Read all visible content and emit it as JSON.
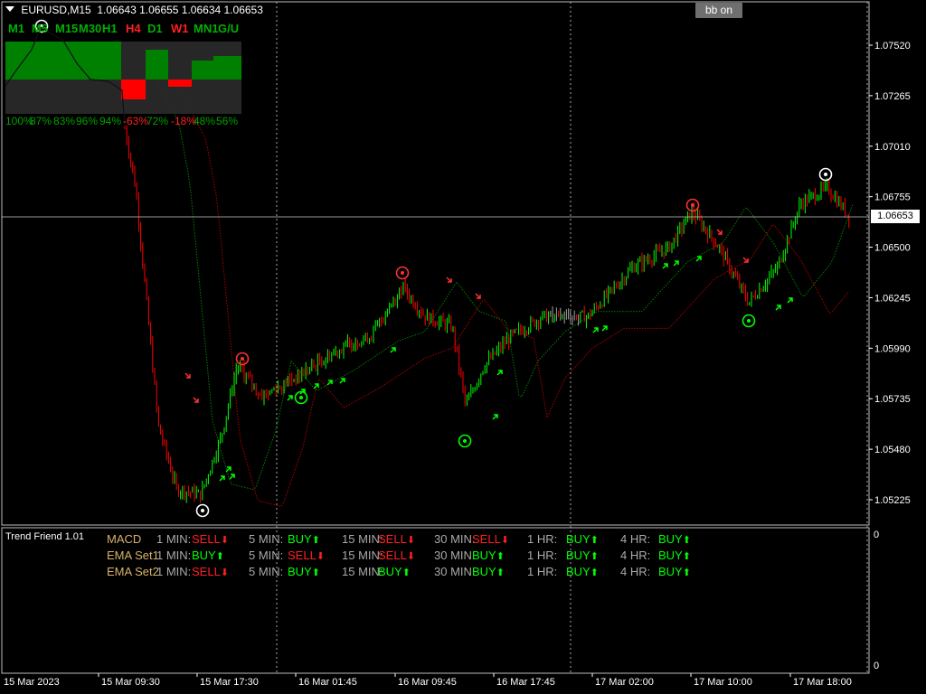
{
  "header": {
    "symbol": "EURUSD,M15",
    "ohlc": "1.06643 1.06655 1.06634 1.06653"
  },
  "toolbar": {
    "bb_label": "bb on"
  },
  "colors": {
    "bull": "#00ff00",
    "bear": "#ff0000",
    "neutral": "#a0a0a0",
    "grid": "#aaaaaa",
    "panel_green": "#008000",
    "panel_dark": "#2a2a2a"
  },
  "price_axis": {
    "labels": [
      "1.07520",
      "1.07265",
      "1.07010",
      "1.06755",
      "1.06500",
      "1.06245",
      "1.05990",
      "1.05735",
      "1.05480",
      "1.05225"
    ],
    "current": "1.06653"
  },
  "time_axis": [
    "15 Mar 2023",
    "15 Mar 09:30",
    "15 Mar 17:30",
    "16 Mar 01:45",
    "16 Mar 09:45",
    "16 Mar 17:45",
    "17 Mar 02:00",
    "17 Mar 10:00",
    "17 Mar 18:00"
  ],
  "strength_panel": {
    "timeframes": [
      {
        "name": "M1",
        "state": "up"
      },
      {
        "name": "M5",
        "state": "up"
      },
      {
        "name": "M15",
        "state": "up"
      },
      {
        "name": "M30",
        "state": "up"
      },
      {
        "name": "H1",
        "state": "up"
      },
      {
        "name": "H4",
        "state": "down"
      },
      {
        "name": "D1",
        "state": "up"
      },
      {
        "name": "W1",
        "state": "down"
      },
      {
        "name": "MN1",
        "state": "up"
      },
      {
        "name": "G/U",
        "state": "up"
      }
    ],
    "percents": [
      {
        "text": "100%",
        "state": "up"
      },
      {
        "text": "87%",
        "state": "up"
      },
      {
        "text": "83%",
        "state": "up"
      },
      {
        "text": "96%",
        "state": "up"
      },
      {
        "text": "94%",
        "state": "up"
      },
      {
        "text": "-63%",
        "state": "down"
      },
      {
        "text": "72%",
        "state": "up"
      },
      {
        "text": "-18%",
        "state": "down"
      },
      {
        "text": "48%",
        "state": "up"
      },
      {
        "text": "56%",
        "state": "up"
      }
    ]
  },
  "subwindow": {
    "title": "Trend Friend 1.01",
    "zero_top": "0",
    "zero_bottom": "0",
    "timeframes": [
      "1 MIN:",
      "5 MIN:",
      "15 MIN:",
      "30 MIN:",
      "1 HR:",
      "4 HR:"
    ],
    "rows": [
      {
        "label": "MACD",
        "signals": [
          "SELL",
          "BUY",
          "SELL",
          "SELL",
          "BUY",
          "BUY"
        ]
      },
      {
        "label": "EMA Set1",
        "signals": [
          "BUY",
          "SELL",
          "SELL",
          "BUY",
          "BUY",
          "BUY"
        ]
      },
      {
        "label": "EMA Set2",
        "signals": [
          "SELL",
          "BUY",
          "BUY",
          "BUY",
          "BUY",
          "BUY"
        ]
      }
    ]
  }
}
